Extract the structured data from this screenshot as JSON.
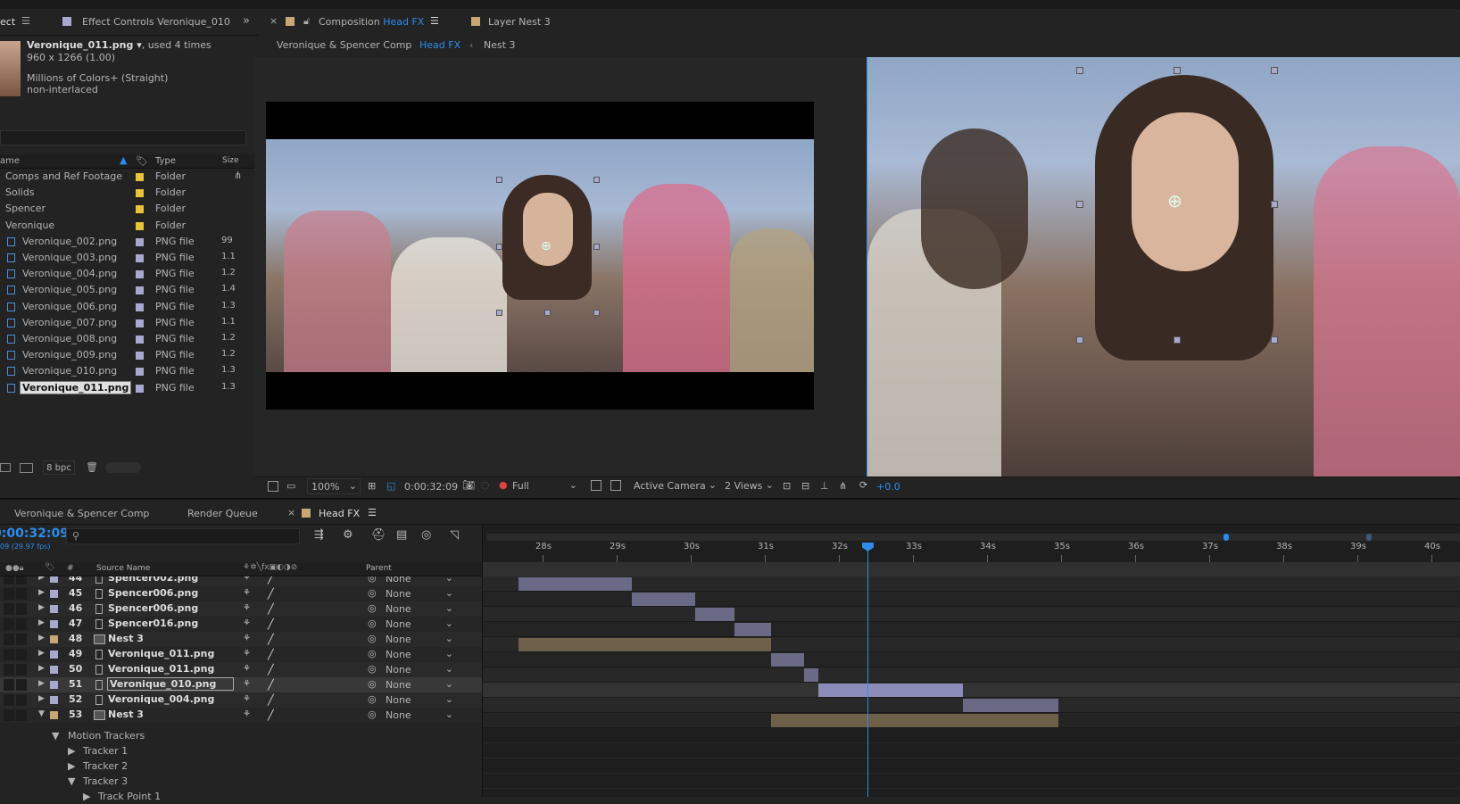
{
  "top": {
    "tabs": [
      {
        "label": "ect"
      },
      {
        "label": "Effect Controls Veronique_010"
      }
    ],
    "comp_tab_title_prefix": "Composition",
    "comp_tab_title_name": "Head FX",
    "layer_tab": "Layer Nest 3"
  },
  "comp_breadcrumb": [
    "Veronique & Spencer Comp",
    "Head FX",
    "Nest 3"
  ],
  "project": {
    "asset_name": "Veronique_011.png",
    "asset_used": ", used 4 times",
    "asset_dims": "960 x 1266 (1.00)",
    "asset_colors": "Millions of Colors+ (Straight)",
    "asset_interlace": "non-interlaced",
    "search_placeholder": "",
    "columns": {
      "name": "ame",
      "type": "Type",
      "size": "Size"
    },
    "items": [
      {
        "name": "Comps and Ref Footage",
        "type": "Folder",
        "size": "",
        "color": "#e8c43a",
        "kind": "folder"
      },
      {
        "name": "Solids",
        "type": "Folder",
        "size": "",
        "color": "#e8c43a",
        "kind": "folder"
      },
      {
        "name": "Spencer",
        "type": "Folder",
        "size": "",
        "color": "#e8c43a",
        "kind": "folder"
      },
      {
        "name": "Veronique",
        "type": "Folder",
        "size": "",
        "color": "#e8c43a",
        "kind": "folder"
      },
      {
        "name": "Veronique_002.png",
        "type": "PNG file",
        "size": "99",
        "color": "#a9a9cf",
        "kind": "file"
      },
      {
        "name": "Veronique_003.png",
        "type": "PNG file",
        "size": "1.1",
        "color": "#a9a9cf",
        "kind": "file"
      },
      {
        "name": "Veronique_004.png",
        "type": "PNG file",
        "size": "1.2",
        "color": "#a9a9cf",
        "kind": "file"
      },
      {
        "name": "Veronique_005.png",
        "type": "PNG file",
        "size": "1.4",
        "color": "#a9a9cf",
        "kind": "file"
      },
      {
        "name": "Veronique_006.png",
        "type": "PNG file",
        "size": "1.3",
        "color": "#a9a9cf",
        "kind": "file"
      },
      {
        "name": "Veronique_007.png",
        "type": "PNG file",
        "size": "1.1",
        "color": "#a9a9cf",
        "kind": "file"
      },
      {
        "name": "Veronique_008.png",
        "type": "PNG file",
        "size": "1.2",
        "color": "#a9a9cf",
        "kind": "file"
      },
      {
        "name": "Veronique_009.png",
        "type": "PNG file",
        "size": "1.2",
        "color": "#a9a9cf",
        "kind": "file"
      },
      {
        "name": "Veronique_010.png",
        "type": "PNG file",
        "size": "1.3",
        "color": "#a9a9cf",
        "kind": "file"
      },
      {
        "name": "Veronique_011.png",
        "type": "PNG file",
        "size": "1.3",
        "color": "#a9a9cf",
        "kind": "file"
      }
    ],
    "bpc": "8 bpc"
  },
  "viewer_toolbar": {
    "zoom": "100%",
    "timecode": "0:00:32:09",
    "resolution": "Full",
    "camera": "Active Camera",
    "views": "2 Views",
    "exposure": "+0.0"
  },
  "timeline": {
    "tabs": [
      "Veronique & Spencer Comp",
      "Render Queue",
      "Head FX"
    ],
    "timecode": "0:00:32:09",
    "fps": "09 (29.97 fps)",
    "columns": {
      "num": "#",
      "source": "Source Name",
      "parent": "Parent"
    },
    "ruler": [
      "28s",
      "29s",
      "30s",
      "31s",
      "32s",
      "33s",
      "34s",
      "35s",
      "36s",
      "37s",
      "38s",
      "39s",
      "40s"
    ],
    "layers": [
      {
        "num": "44",
        "name": "Spencer002.png",
        "parent": "None",
        "color": "#a9a9cf",
        "kind": "file"
      },
      {
        "num": "45",
        "name": "Spencer006.png",
        "parent": "None",
        "color": "#a9a9cf",
        "kind": "file"
      },
      {
        "num": "46",
        "name": "Spencer006.png",
        "parent": "None",
        "color": "#a9a9cf",
        "kind": "file"
      },
      {
        "num": "47",
        "name": "Spencer016.png",
        "parent": "None",
        "color": "#a9a9cf",
        "kind": "file"
      },
      {
        "num": "48",
        "name": "Nest 3",
        "parent": "None",
        "color": "#c8a775",
        "kind": "comp"
      },
      {
        "num": "49",
        "name": "Veronique_011.png",
        "parent": "None",
        "color": "#a9a9cf",
        "kind": "file"
      },
      {
        "num": "50",
        "name": "Veronique_011.png",
        "parent": "None",
        "color": "#a9a9cf",
        "kind": "file"
      },
      {
        "num": "51",
        "name": "Veronique_010.png",
        "parent": "None",
        "color": "#a9a9cf",
        "kind": "file"
      },
      {
        "num": "52",
        "name": "Veronique_004.png",
        "parent": "None",
        "color": "#a9a9cf",
        "kind": "file"
      },
      {
        "num": "53",
        "name": "Nest 3",
        "parent": "None",
        "color": "#c8a775",
        "kind": "comp"
      }
    ],
    "sub_items": [
      "Motion Trackers",
      "Tracker 1",
      "Tracker 2",
      "Tracker 3",
      "Track Point 1"
    ]
  }
}
